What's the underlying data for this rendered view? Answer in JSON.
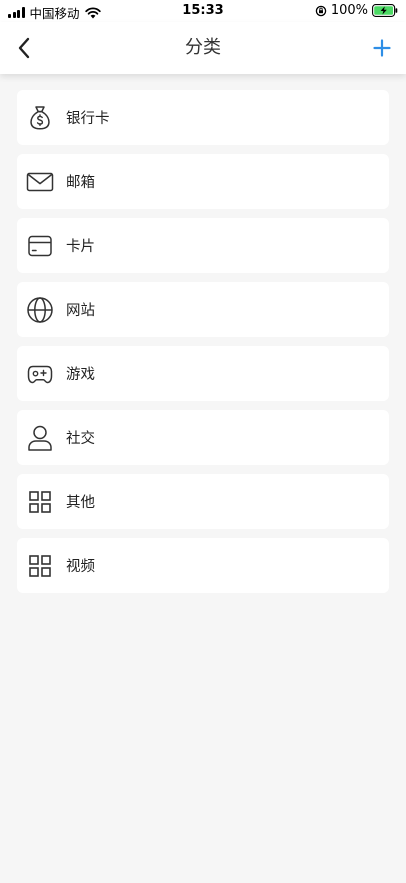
{
  "status_bar": {
    "carrier": "中国移动",
    "time": "15:33",
    "battery": "100%"
  },
  "nav": {
    "title": "分类",
    "back_icon": "chevron-left-icon",
    "add_icon": "plus-icon",
    "accent_color": "#2e8ee6"
  },
  "categories": [
    {
      "label": "银行卡",
      "icon": "money-bag-icon"
    },
    {
      "label": "邮箱",
      "icon": "envelope-icon"
    },
    {
      "label": "卡片",
      "icon": "card-icon"
    },
    {
      "label": "网站",
      "icon": "globe-icon"
    },
    {
      "label": "游戏",
      "icon": "gamepad-icon"
    },
    {
      "label": "社交",
      "icon": "person-icon"
    },
    {
      "label": "其他",
      "icon": "grid-icon"
    },
    {
      "label": "视频",
      "icon": "grid-icon"
    }
  ]
}
